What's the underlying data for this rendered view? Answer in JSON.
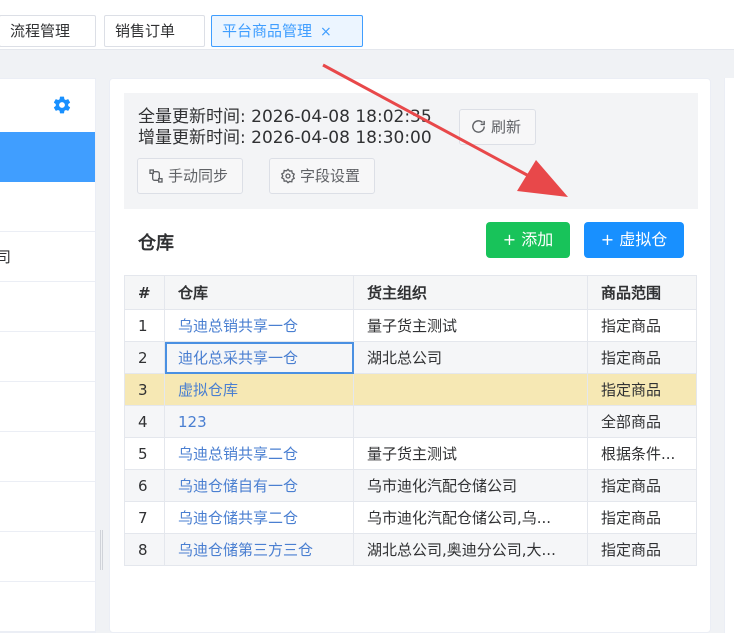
{
  "tabs": [
    {
      "label": "流程管理",
      "active": false
    },
    {
      "label": "销售订单",
      "active": false
    },
    {
      "label": "平台商品管理",
      "active": true
    }
  ],
  "tab_close_glyph": "×",
  "sidebar": {
    "partial_row_text": "司"
  },
  "sync_info": {
    "full_update_label": "全量更新时间:",
    "full_update_time": "2026-04-08 18:02:35",
    "incr_update_label": "增量更新时间:",
    "incr_update_time": "2026-04-08 18:30:00",
    "refresh_label": "刷新",
    "manual_sync_label": "手动同步",
    "field_settings_label": "字段设置"
  },
  "warehouse_section": {
    "title": "仓库",
    "add_label": "+ 添加",
    "virtual_label": "+ 虚拟仓"
  },
  "table": {
    "columns": [
      "#",
      "仓库",
      "货主组织",
      "商品范围"
    ],
    "rows": [
      {
        "no": "1",
        "warehouse": "乌迪总销共享一仓",
        "owner": "量子货主测试",
        "scope": "指定商品"
      },
      {
        "no": "2",
        "warehouse": "迪化总采共享一仓",
        "owner": "湖北总公司",
        "scope": "指定商品"
      },
      {
        "no": "3",
        "warehouse": "虚拟仓库",
        "owner": "",
        "scope": "指定商品"
      },
      {
        "no": "4",
        "warehouse": "123",
        "owner": "",
        "scope": "全部商品"
      },
      {
        "no": "5",
        "warehouse": "乌迪总销共享二仓",
        "owner": "量子货主测试",
        "scope": "根据条件..."
      },
      {
        "no": "6",
        "warehouse": "乌迪仓储自有一仓",
        "owner": "乌市迪化汽配仓储公司",
        "scope": "指定商品"
      },
      {
        "no": "7",
        "warehouse": "乌迪仓储共享二仓",
        "owner": "乌市迪化汽配仓储公司,乌...",
        "scope": "指定商品"
      },
      {
        "no": "8",
        "warehouse": "乌迪仓储第三方三仓",
        "owner": "湖北总公司,奥迪分公司,大...",
        "scope": "指定商品"
      }
    ]
  },
  "colors": {
    "primary": "#1890ff",
    "success": "#18c35a",
    "annotation_arrow": "#e8484a",
    "highlight_row": "#f6e8b4"
  },
  "icons": [
    "gear-icon",
    "refresh-icon",
    "sync-icon",
    "settings-icon",
    "close-icon",
    "annotation-arrow"
  ]
}
